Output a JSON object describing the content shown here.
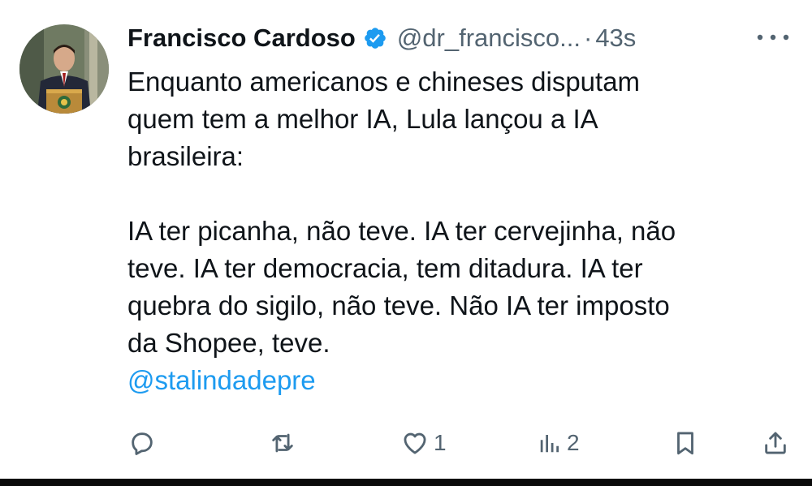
{
  "tweet": {
    "author": {
      "display_name": "Francisco Cardoso",
      "handle": "@dr_francisco...",
      "verified": true
    },
    "separator": "·",
    "timestamp": "43s",
    "text_paragraph_1": "Enquanto americanos e chineses disputam\nquem tem a melhor IA, Lula lançou a IA\nbrasileira:",
    "text_paragraph_2": "IA ter picanha, não teve. IA ter cervejinha, não\nteve. IA ter democracia, tem ditadura. IA ter\nquebra do sigilo,  não teve. Não IA ter imposto\nda Shopee, teve.",
    "mention": "@stalindadepre"
  },
  "actions": {
    "reply": {
      "icon": "reply-icon",
      "count": ""
    },
    "retweet": {
      "icon": "retweet-icon",
      "count": ""
    },
    "like": {
      "icon": "heart-icon",
      "count": "1"
    },
    "views": {
      "icon": "views-icon",
      "count": "2"
    },
    "bookmark": {
      "icon": "bookmark-icon"
    },
    "share": {
      "icon": "share-icon"
    }
  },
  "colors": {
    "text": "#0f1419",
    "secondary": "#536471",
    "link": "#1d9bf0",
    "verified": "#1d9bf0"
  }
}
